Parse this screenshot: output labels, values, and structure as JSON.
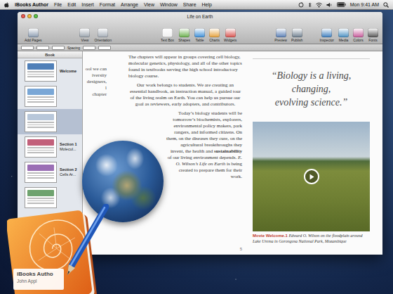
{
  "menu_bar": {
    "app": "iBooks Author",
    "items": [
      "File",
      "Edit",
      "Insert",
      "Format",
      "Arrange",
      "View",
      "Window",
      "Share",
      "Help"
    ],
    "clock": "Mon 9:41 AM"
  },
  "window": {
    "title": "Life on Earth"
  },
  "toolbar": {
    "groups": [
      [
        "Add Pages"
      ],
      [
        "View",
        "Orientation"
      ],
      [
        "Text Box",
        "Shapes",
        "Table",
        "Charts",
        "Widgets"
      ],
      [
        "Preview",
        "Publish"
      ],
      [
        "Inspector",
        "Media",
        "Colors",
        "Fonts"
      ]
    ]
  },
  "format_bar": {
    "label": "Spacing"
  },
  "sidebar": {
    "title": "Book",
    "items": [
      {
        "lines": [
          "Welcome"
        ],
        "selected": false
      },
      {
        "lines": [],
        "selected": false
      },
      {
        "lines": [],
        "selected": true
      },
      {
        "lines": [
          "Section 1",
          "Molecul..."
        ],
        "selected": false
      },
      {
        "lines": [
          "Section 2",
          "Cells Ar..."
        ],
        "selected": false
      },
      {
        "lines": [],
        "selected": false
      }
    ]
  },
  "page": {
    "fragments": [
      "ool we can",
      "iversity",
      "designers,",
      "l",
      "chapter"
    ],
    "paragraphs": [
      {
        "runs": [
          {
            "text": "The chapters will appear in groups covering cell biology, molecular genetics, physiology, and all of the other topics found in textbooks serving the high school introductory biology course.",
            "kind": "plain"
          }
        ]
      },
      {
        "runs": [
          {
            "text": "Our work belongs to students. We are creating an essential handbook, an instruction manual, a guided tour of the living realm on Earth. You can help us pursue our goal as reviewers, early adopters, and contributors.",
            "kind": "plain"
          }
        ]
      },
      {
        "runs": [
          {
            "text": "Today’s biology students will be tomorrow’s biochemists, explorers, environmental policy makers, park rangers, and informed citizens. On them, on the diseases they cure, on the agricultural breakthroughs they invent, the health and ",
            "kind": "plain"
          },
          {
            "text": "sustainability",
            "kind": "bold"
          },
          {
            "text": " of our living environment depends. ",
            "kind": "plain"
          },
          {
            "text": "E. O. Wilson’s Life on Earth",
            "kind": "italic"
          },
          {
            "text": " is being created to prepare them for their work.",
            "kind": "plain"
          }
        ]
      }
    ],
    "quote": [
      "“Biology is a living,",
      "changing,",
      "evolving science.”"
    ],
    "caption": {
      "label": "Movie Welcome.1",
      "text": " Edward O. Wilson on the floodplain around Lake Urema in Gorongosa National Park, Mozambique"
    },
    "page_number": "5"
  },
  "app_icon": {
    "lines": [
      "iBooks Autho",
      "John Appl"
    ]
  }
}
